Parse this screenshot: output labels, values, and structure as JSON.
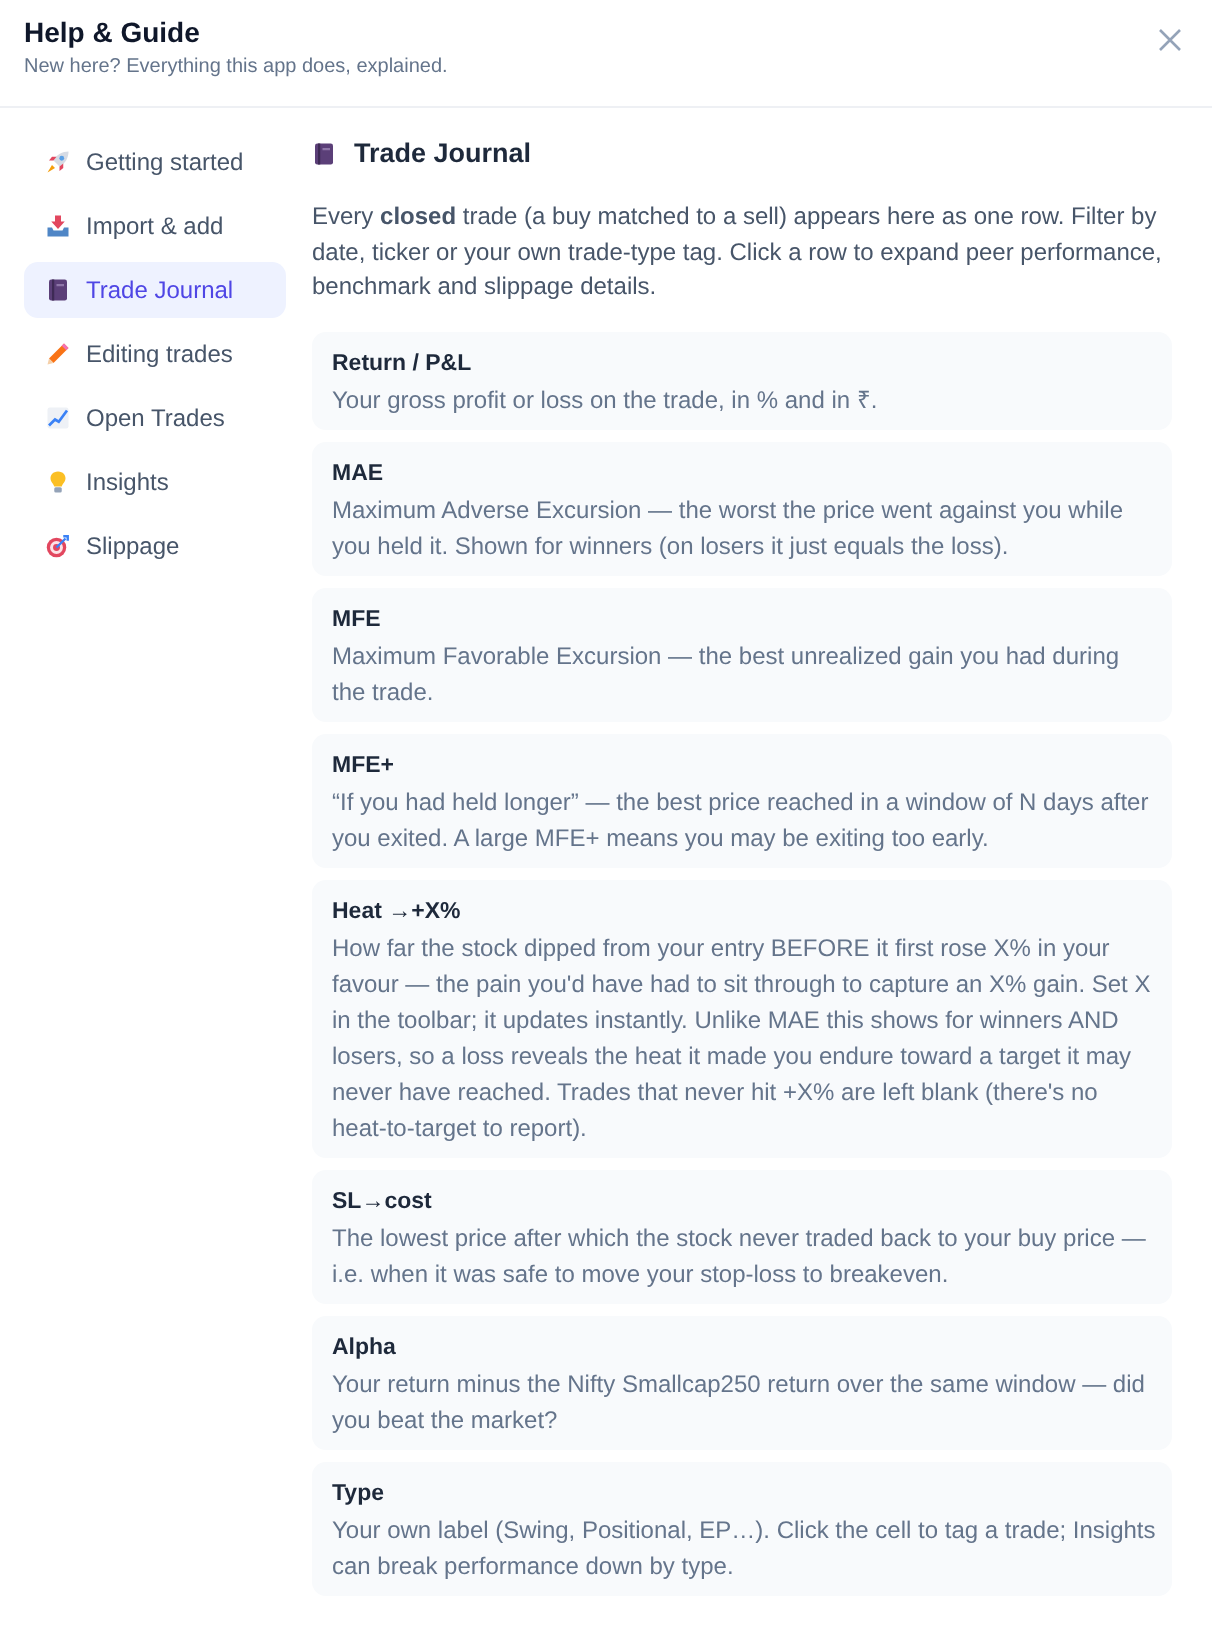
{
  "dialog": {
    "title": "Help & Guide",
    "subtitle": "New here? Everything this app does, explained."
  },
  "sidebar": {
    "items": [
      {
        "label": "Getting started",
        "selected": false
      },
      {
        "label": "Import & add",
        "selected": false
      },
      {
        "label": "Trade Journal",
        "selected": true
      },
      {
        "label": "Editing trades",
        "selected": false
      },
      {
        "label": "Open Trades",
        "selected": false
      },
      {
        "label": "Insights",
        "selected": false
      },
      {
        "label": "Slippage",
        "selected": false
      }
    ]
  },
  "section": {
    "title": "Trade Journal",
    "intro": "Every **closed** trade (a buy matched to a sell) appears here as one row. Filter by date, ticker or your own trade-type tag. Click a row to expand peer performance, benchmark and slippage details.",
    "terms": [
      {
        "term": "Return / P&L",
        "definition": "Your gross profit or loss on the trade, in % and in ₹."
      },
      {
        "term": "MAE",
        "definition": "Maximum Adverse Excursion — the worst the price went against you while you held it. Shown for winners (on losers it just equals the loss)."
      },
      {
        "term": "MFE",
        "definition": "Maximum Favorable Excursion — the best unrealized gain you had during the trade."
      },
      {
        "term": "MFE+",
        "definition": "“If you had held longer” — the best price reached in a window of N days after you exited. A large MFE+ means you may be exiting too early."
      },
      {
        "term": "Heat →+X%",
        "definition": "How far the stock dipped from your entry BEFORE it first rose X% in your favour — the pain you'd have had to sit through to capture an X% gain. Set X in the toolbar; it updates instantly. Unlike MAE this shows for winners AND losers, so a loss reveals the heat it made you endure toward a target it may never have reached. Trades that never hit +X% are left blank (there's no heat-to-target to report)."
      },
      {
        "term": "SL→cost",
        "definition": "The lowest price after which the stock never traded back to your buy price — i.e. when it was safe to move your stop-loss to breakeven."
      },
      {
        "term": "Alpha",
        "definition": "Your return minus the Nifty Smallcap250 return over the same window — did you beat the market?"
      },
      {
        "term": "Type",
        "definition": "Your own label (Swing, Positional, EP…). Click the cell to tag a trade; Insights can break performance down by type."
      }
    ]
  }
}
